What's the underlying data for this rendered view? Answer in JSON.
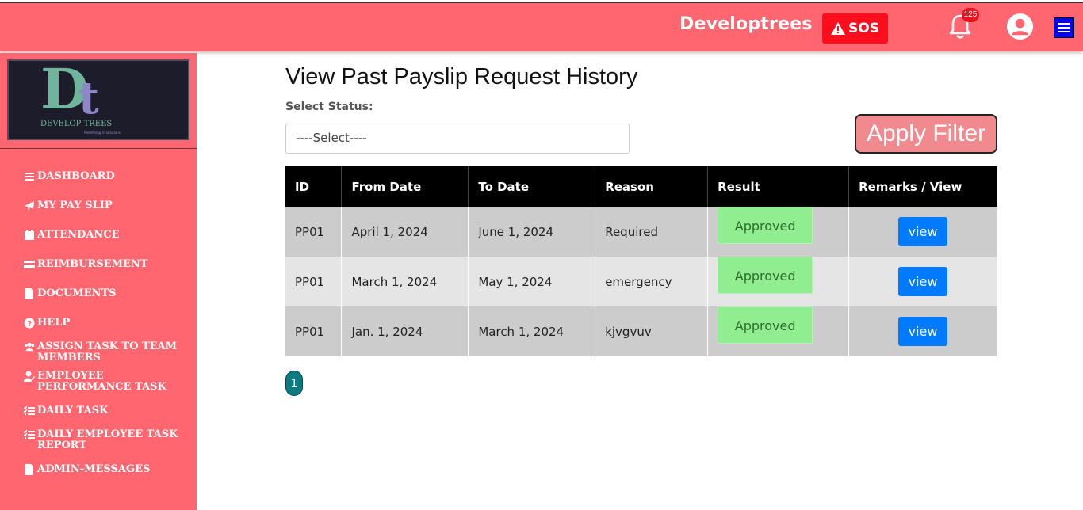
{
  "header": {
    "brand": "Developtrees",
    "sos_label": "SOS",
    "notification_count": "125",
    "colors": {
      "bar": "#ff6670",
      "sos": "#ff0d1d",
      "menu": "#0000ff"
    }
  },
  "sidebar": {
    "logo_text": "DEVELOP TREES",
    "logo_tagline": "Redefining IT Solutions",
    "items": [
      {
        "label": "DASHBOARD",
        "icon": "list-icon"
      },
      {
        "label": "MY PAY SLIP",
        "icon": "paper-plane-icon"
      },
      {
        "label": "ATTENDANCE",
        "icon": "calendar-icon"
      },
      {
        "label": "REIMBURSEMENT",
        "icon": "credit-card-icon"
      },
      {
        "label": "DOCUMENTS",
        "icon": "file-icon"
      },
      {
        "label": "HELP",
        "icon": "question-circle-icon"
      },
      {
        "label": "ASSIGN TASK TO TEAM MEMBERS",
        "icon": "users-icon"
      },
      {
        "label": "EMPLOYEE PERFORMANCE TASK",
        "icon": "user-edit-icon"
      },
      {
        "label": "DAILY TASK",
        "icon": "task-list-icon"
      },
      {
        "label": "DAILY EMPLOYEE TASK REPORT",
        "icon": "task-list-icon"
      },
      {
        "label": "ADMIN-MESSAGES",
        "icon": "file-icon"
      }
    ]
  },
  "main": {
    "title": "View Past Payslip Request History",
    "status_label": "Select Status:",
    "select_value": "----Select----",
    "apply_label": "Apply Filter",
    "table": {
      "columns": [
        "ID",
        "From Date",
        "To Date",
        "Reason",
        "Result",
        "Remarks / View"
      ],
      "rows": [
        {
          "id": "PP01",
          "from": "April 1, 2024",
          "to": "June 1, 2024",
          "reason": "Required",
          "result": "Approved",
          "action": "view"
        },
        {
          "id": "PP01",
          "from": "March 1, 2024",
          "to": "May 1, 2024",
          "reason": "emergency",
          "result": "Approved",
          "action": "view"
        },
        {
          "id": "PP01",
          "from": "Jan. 1, 2024",
          "to": "March 1, 2024",
          "reason": "kjvgvuv",
          "result": "Approved",
          "action": "view"
        }
      ]
    },
    "pagination": {
      "current_page": "1"
    }
  }
}
